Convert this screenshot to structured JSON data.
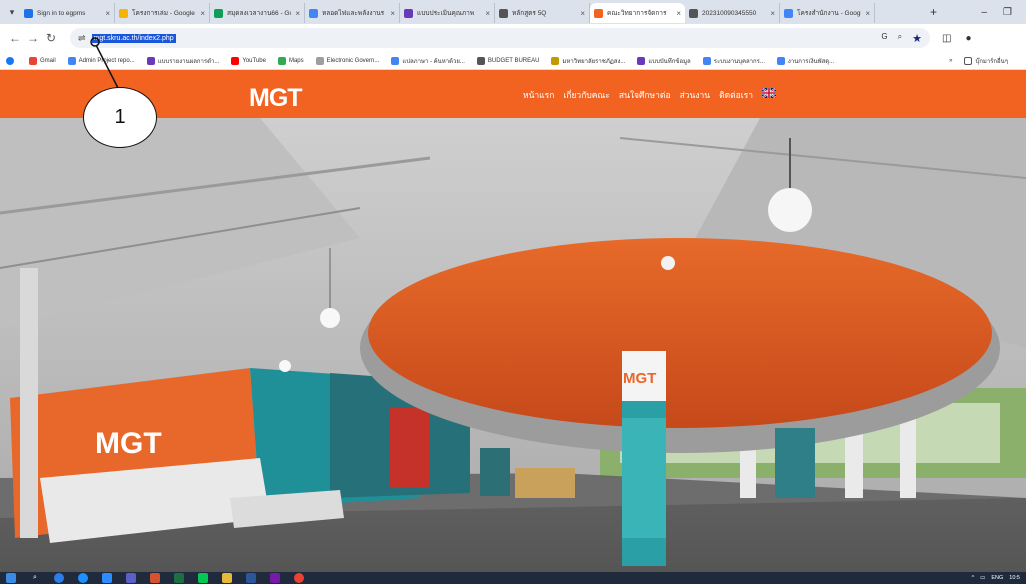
{
  "browser": {
    "tabs": [
      {
        "title": "Sign in to egpms",
        "color": "#1a73e8"
      },
      {
        "title": "โครงการเล่ม - Google",
        "color": "#f4b400"
      },
      {
        "title": "สมุดลงเวลางาน66 - Go",
        "color": "#0f9d58"
      },
      {
        "title": "หลอดไฟและพลังงานร",
        "color": "#4285f4"
      },
      {
        "title": "แบบประเมินคุณภาพ",
        "color": "#673ab7"
      },
      {
        "title": "หลักสูตร 5Q",
        "color": "#555555"
      },
      {
        "title": "คณะวิทยาการจัดการ",
        "color": "#f26321",
        "active": true
      },
      {
        "title": "202310090345550",
        "color": "#555555"
      },
      {
        "title": "โครงสำนักงาน - Google",
        "color": "#4285f4"
      }
    ],
    "url": "mgt.skru.ac.th/index2.php",
    "bookmarks": [
      {
        "label": "Gmail",
        "color": "#ea4335"
      },
      {
        "label": "Admin Project repo...",
        "color": "#4285f4"
      },
      {
        "label": "แบบรายงานผลการดำ...",
        "color": "#673ab7"
      },
      {
        "label": "YouTube",
        "color": "#ff0000"
      },
      {
        "label": "Maps",
        "color": "#34a853"
      },
      {
        "label": "Electronic Govern...",
        "color": "#9e9e9e"
      },
      {
        "label": "แปลภาษา - ค้นหาด้วย...",
        "color": "#4285f4"
      },
      {
        "label": "BUDGET BUREAU",
        "color": "#555555"
      },
      {
        "label": "มหาวิทยาลัยราชภัฏสง...",
        "color": "#c09a00"
      },
      {
        "label": "แบบบันทึกข้อมูล",
        "color": "#673ab7"
      },
      {
        "label": "ระบบงานบุคลากร...",
        "color": "#4285f4"
      },
      {
        "label": "งานการเงินพัสดุ...",
        "color": "#4285f4"
      }
    ],
    "other_bookmarks": "บุ๊กมาร์กอื่นๆ"
  },
  "site": {
    "logo": "MGT",
    "nav": [
      "หน้าแรก",
      "เกี่ยวกับคณะ",
      "สนใจศึกษาต่อ",
      "ส่วนงาน",
      "ติดต่อเรา"
    ],
    "brand_color": "#f26321"
  },
  "callout": {
    "label": "1"
  },
  "tray": {
    "lang": "ENG",
    "time": "10:5"
  }
}
